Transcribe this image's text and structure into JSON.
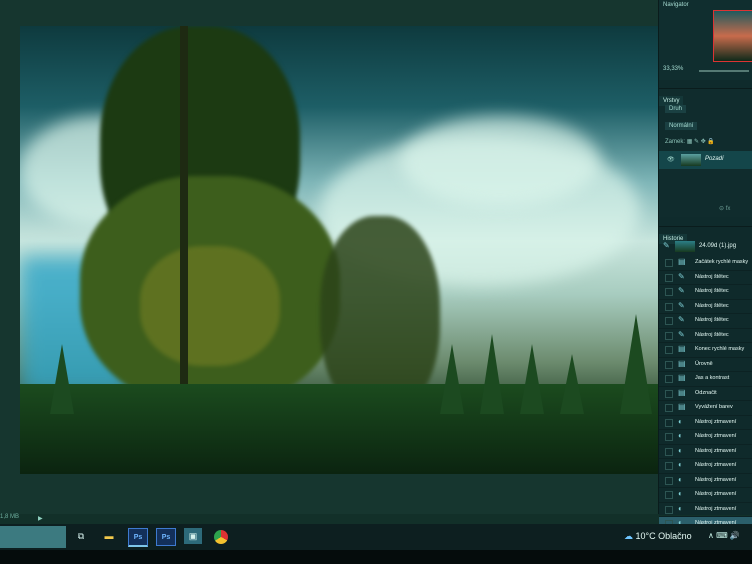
{
  "status": {
    "doc_size": "1,8 MB",
    "arrow": "▶"
  },
  "navigator": {
    "title": "Navigator",
    "zoom": "33,33%"
  },
  "layers": {
    "tab": "Vrstvy",
    "filter_kind": "Druh",
    "blend_mode": "Normální",
    "lock_label": "Zamek:",
    "lock_icons": "▦ ✎ ✥ 🔒",
    "layer_name": "Pozadí",
    "footer_icons": "⊝ fx"
  },
  "history": {
    "tab": "Historie",
    "snapshot": "24.09d (1).jpg",
    "items": [
      {
        "label": "Začátek rychlé masky",
        "icon": "mask-icon"
      },
      {
        "label": "Nástroj štětec",
        "icon": "brush-icon"
      },
      {
        "label": "Nástroj štětec",
        "icon": "brush-icon"
      },
      {
        "label": "Nástroj štětec",
        "icon": "brush-icon"
      },
      {
        "label": "Nástroj štětec",
        "icon": "brush-icon"
      },
      {
        "label": "Nástroj štětec",
        "icon": "brush-icon"
      },
      {
        "label": "Konec rychlé masky",
        "icon": "mask-icon"
      },
      {
        "label": "Úrovně",
        "icon": "doc-icon"
      },
      {
        "label": "Jas a kontrast",
        "icon": "doc-icon"
      },
      {
        "label": "Odznačit",
        "icon": "doc-icon"
      },
      {
        "label": "Vyvážení barev",
        "icon": "doc-icon"
      },
      {
        "label": "Nástroj ztmavení",
        "icon": "dodge-icon"
      },
      {
        "label": "Nástroj ztmavení",
        "icon": "dodge-icon"
      },
      {
        "label": "Nástroj ztmavení",
        "icon": "dodge-icon"
      },
      {
        "label": "Nástroj ztmavení",
        "icon": "dodge-icon"
      },
      {
        "label": "Nástroj ztmavení",
        "icon": "dodge-icon"
      },
      {
        "label": "Nástroj ztmavení",
        "icon": "dodge-icon"
      },
      {
        "label": "Nástroj ztmavení",
        "icon": "dodge-icon"
      },
      {
        "label": "Nástroj ztmavení",
        "icon": "dodge-icon"
      }
    ]
  },
  "taskbar": {
    "ps_label": "Ps",
    "weather_temp": "10°C",
    "weather_text": "Oblačno",
    "tray": "∧ ⌨ 🔊"
  }
}
